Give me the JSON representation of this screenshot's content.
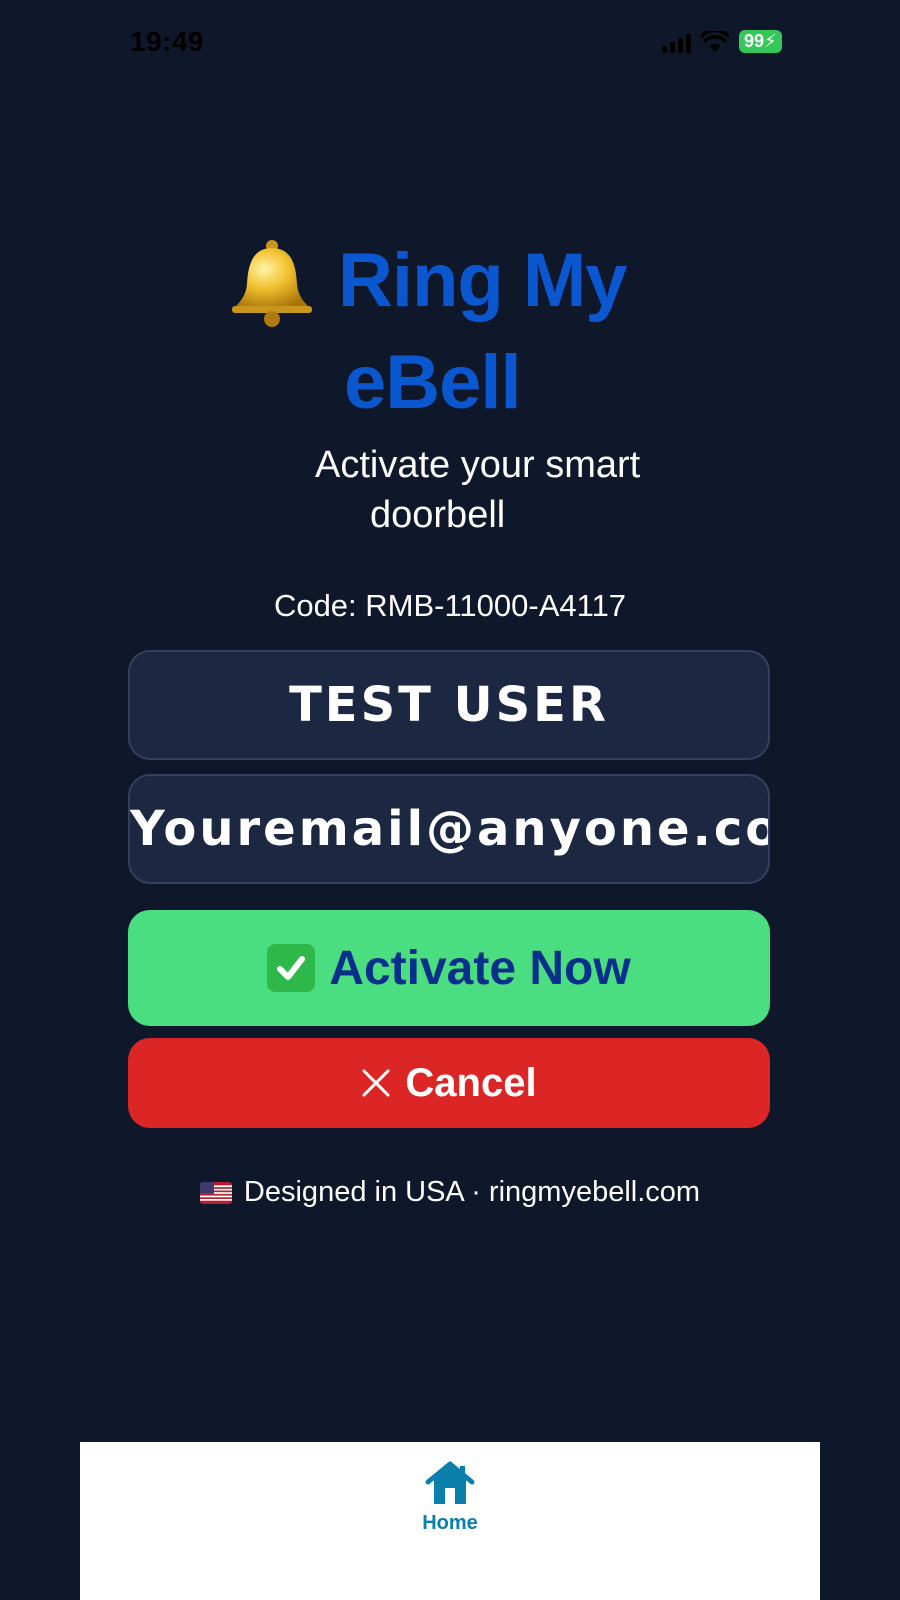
{
  "status_bar": {
    "time": "19:49",
    "battery": "99",
    "icons": [
      "signal-icon",
      "wifi-icon",
      "battery-charging-icon"
    ]
  },
  "header": {
    "bell_icon": "bell-icon",
    "title_line1": "Ring My",
    "title_line2": "eBell",
    "subtitle_line1": "Activate your smart",
    "subtitle_line2": "doorbell"
  },
  "activation": {
    "code_text": "Code: RMB-11000-A4117",
    "name_value": "TEST USER",
    "email_value": "Youremail@anyone.co",
    "activate_label": "Activate Now",
    "activate_icon": "check-box-icon",
    "cancel_label": "Cancel",
    "cancel_icon": "close-icon"
  },
  "footer": {
    "flag_icon": "us-flag-icon",
    "text": "Designed in USA · ringmyebell.com"
  },
  "tabbar": {
    "items": [
      {
        "label": "Home",
        "icon": "home-icon",
        "active": true
      }
    ]
  },
  "colors": {
    "background": "#0f172a",
    "brand_blue": "#0b57d0",
    "activate_green": "#4ade80",
    "cancel_red": "#dc2626",
    "field_bg": "#1c2742",
    "tab_active": "#0b7fab"
  }
}
